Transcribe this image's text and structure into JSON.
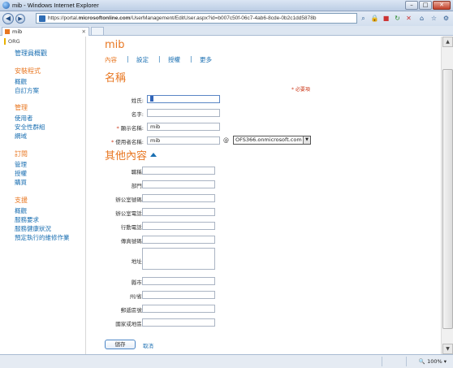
{
  "window": {
    "title": "mib - Windows Internet Explorer",
    "url_plain": "https://portal.",
    "url_domain": "microsoftonline.com",
    "url_rest": "/UserManagement/EditUser.aspx?id=b007c50f-06c7-4ab6-8cde-0b2c1dd5878b",
    "tab_label": "mib"
  },
  "sidebar": {
    "org": "ORG",
    "overview": "管理員概觀",
    "groups": [
      {
        "heading": "安裝程式",
        "items": [
          "概觀",
          "自訂方案"
        ]
      },
      {
        "heading": "管理",
        "items": [
          "使用者",
          "安全性群組",
          "網域"
        ]
      },
      {
        "heading": "訂閱",
        "items": [
          "管理",
          "授權",
          "購買"
        ]
      },
      {
        "heading": "支援",
        "items": [
          "概觀",
          "服務要求",
          "服務健康狀況",
          "預定執行的維修作業"
        ]
      }
    ]
  },
  "main": {
    "title": "mib",
    "subnav": {
      "active": "內容",
      "settings": "設定",
      "licenses": "授權",
      "more": "更多",
      "sep": "|"
    },
    "section_title": "名稱",
    "required_note": "* 必要項",
    "fields": {
      "last_name": {
        "label": "姓氏:",
        "value": ""
      },
      "first_name": {
        "label": "名字:",
        "value": ""
      },
      "display_name": {
        "label": "顯示名稱:",
        "value": "mib",
        "required": "*"
      },
      "user_name": {
        "label": "使用者名稱:",
        "value": "mib",
        "required": "*"
      }
    },
    "at": "@",
    "domain": "OFS366.onmicrosoft.com",
    "more_title": "其他內容",
    "more_fields": [
      "職稱:",
      "部門:",
      "辦公室號碼:",
      "辦公室電話:",
      "行動電話:",
      "傳真號碼:",
      "地址:",
      "縣市:",
      "州/省:",
      "郵遞區號:",
      "國家或地區:"
    ],
    "save": "儲存",
    "cancel": "取消"
  },
  "status": {
    "zoom": "100%"
  }
}
